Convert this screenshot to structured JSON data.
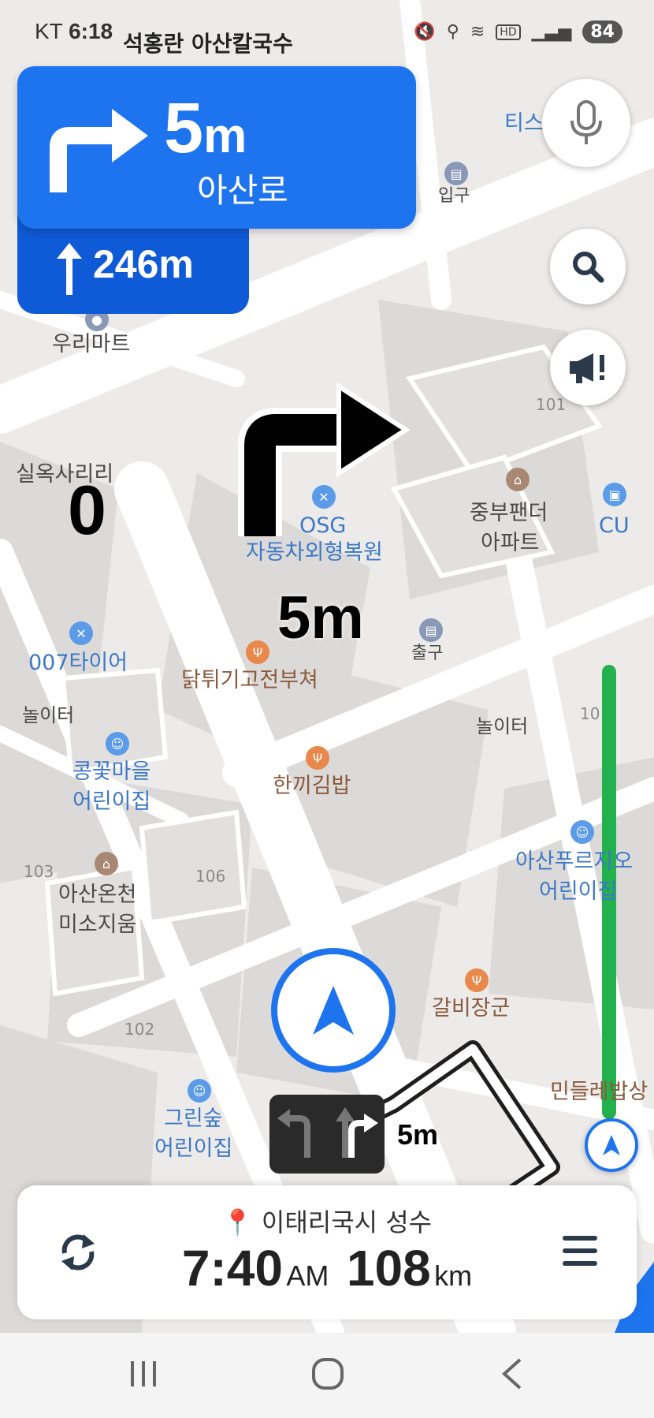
{
  "status_bar": {
    "carrier": "KT",
    "time": "6:18",
    "battery": "84",
    "notification_text": "석홍란 아산칼국수"
  },
  "turn_card": {
    "distance_value": "5",
    "distance_unit": "m",
    "street": "아산로",
    "next_distance": "246m"
  },
  "map": {
    "overlay_speed": "0",
    "overlay_distance": "5m",
    "lane_distance": "5m",
    "pois": {
      "woori_mart": "우리마트",
      "silok": "실옥사리리",
      "osg": "OSG",
      "osg_sub": "자동차외형복원",
      "jungbu": "중부팬더",
      "jungbu_sub": "아파트",
      "cu": "CU",
      "tire": "007타이어",
      "chicken": "닭튀기고전부쳐",
      "exit": "출구",
      "entrance": "입구",
      "playground1": "놀이터",
      "playground2": "놀이터",
      "kimbap": "한끼김밥",
      "kongkkot": "콩꽃마을",
      "kongkkot_sub": "어린이집",
      "asan_oncheon": "아산온천",
      "asan_oncheon_sub": "미소지움",
      "asan_portfolio": "아산푸르지오",
      "asan_portfolio_sub": "어린이집",
      "galbi": "갈비장군",
      "green": "그린숲",
      "green_sub": "어린이집",
      "mindeul": "민들레밥상",
      "tis": "티스",
      "bldg_101": "101",
      "bldg_103": "103",
      "bldg_106": "106",
      "bldg_102": "102",
      "bldg_10": "10"
    }
  },
  "bottom_panel": {
    "destination": "이태리국시 성수",
    "eta_time": "7:40",
    "eta_ampm": "AM",
    "remaining_distance": "108",
    "remaining_unit": "km"
  },
  "colors": {
    "primary_blue": "#1e74ee",
    "route_green": "#22b14c"
  },
  "icons": {
    "mic": "microphone-icon",
    "search": "search-icon",
    "report": "megaphone-icon",
    "reroute": "reroute-icon",
    "menu": "menu-icon",
    "location": "location-arrow-icon"
  }
}
